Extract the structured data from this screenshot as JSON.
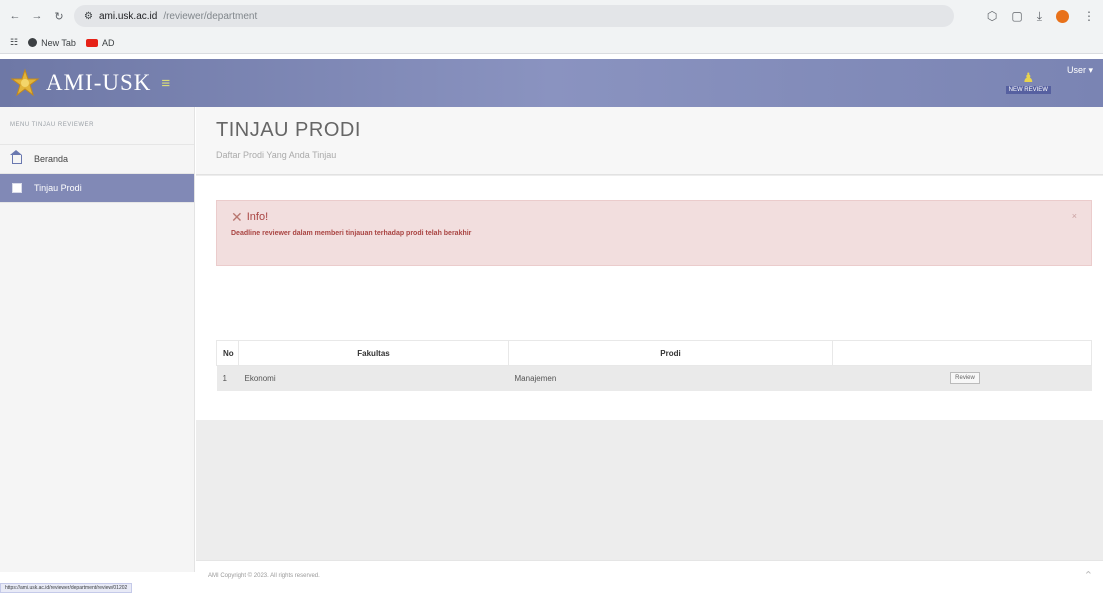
{
  "browser": {
    "url_domain": "ami.usk.ac.id",
    "url_path": "/reviewer/department",
    "bookmarks": [
      {
        "label": "New Tab",
        "icon": "globe-icon"
      },
      {
        "label": "AD",
        "icon": "youtube-icon"
      }
    ],
    "status_url": "https://ami.usk.ac.id/reviewer/department/review/01202"
  },
  "header": {
    "brand": "AMI-USK",
    "notif_label": "NEW REVIEW",
    "user_menu": "User ▾"
  },
  "sidebar": {
    "section_label": "MENU TINJAU REVIEWER",
    "items": [
      {
        "label": "Beranda",
        "icon": "home-icon",
        "active": false
      },
      {
        "label": "Tinjau Prodi",
        "icon": "form-icon",
        "active": true
      }
    ]
  },
  "page": {
    "title": "TINJAU PRODI",
    "subtitle": "Daftar Prodi Yang Anda Tinjau"
  },
  "alert": {
    "title": "Info!",
    "message": "Deadline reviewer dalam memberi tinjauan terhadap prodi telah berakhir"
  },
  "table": {
    "headers": {
      "no": "No",
      "fakultas": "Fakultas",
      "prodi": "Prodi",
      "action": ""
    },
    "rows": [
      {
        "no": "1",
        "fakultas": "Ekonomi",
        "prodi": "Manajemen",
        "action": "Review"
      }
    ]
  },
  "footer": {
    "copyright": "AMI Copyright © 2023. All rights reserved."
  },
  "colors": {
    "header_bg": "#7a84b3",
    "active_item": "#8189b6",
    "alert_bg": "#f2dede",
    "alert_text": "#a94442"
  }
}
